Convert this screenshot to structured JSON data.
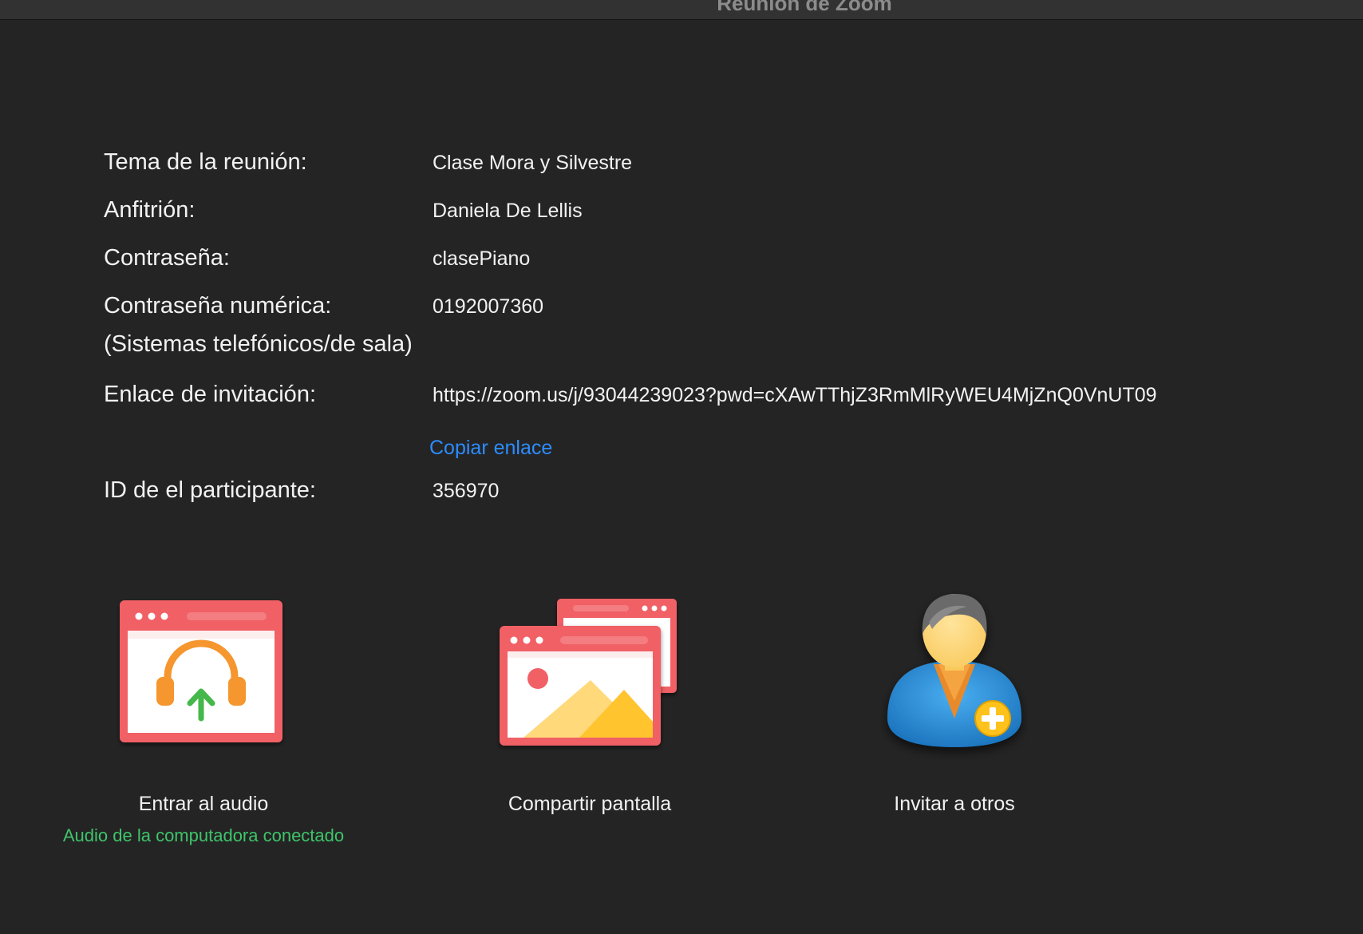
{
  "window": {
    "title": "Reunión de Zoom"
  },
  "meeting_info": {
    "topic_label": "Tema de la reunión:",
    "topic_value": "Clase Mora y Silvestre",
    "host_label": "Anfitrión:",
    "host_value": "Daniela De Lellis",
    "password_label": "Contraseña:",
    "password_value": "clasePiano",
    "numeric_password_label": "Contraseña numérica:",
    "numeric_password_sublabel": "(Sistemas telefónicos/de sala)",
    "numeric_password_value": "0192007360",
    "invite_link_label": "Enlace de invitación:",
    "invite_link_value": "https://zoom.us/j/93044239023?pwd=cXAwTThjZ3RmMlRyWEU4MjZnQ0VnUT09",
    "copy_link_label": "Copiar enlace",
    "participant_id_label": "ID de el participante:",
    "participant_id_value": "356970"
  },
  "actions": {
    "join_audio_label": "Entrar al audio",
    "audio_status": "Audio de la computadora conectado",
    "share_screen_label": "Compartir pantalla",
    "invite_label": "Invitar a otros"
  },
  "colors": {
    "background": "#242424",
    "link": "#2d8cff",
    "status_green": "#3fc46a",
    "window_frame": "#f06065",
    "headphones": "#f5962e",
    "arrow": "#44b84a",
    "person_body": "#2a8fd6",
    "person_skin": "#ffd875",
    "plus_badge": "#ffc21a"
  },
  "icons": {
    "join_audio": "headphones-upload-icon",
    "share_screen": "share-screen-icon",
    "invite": "invite-person-icon"
  }
}
